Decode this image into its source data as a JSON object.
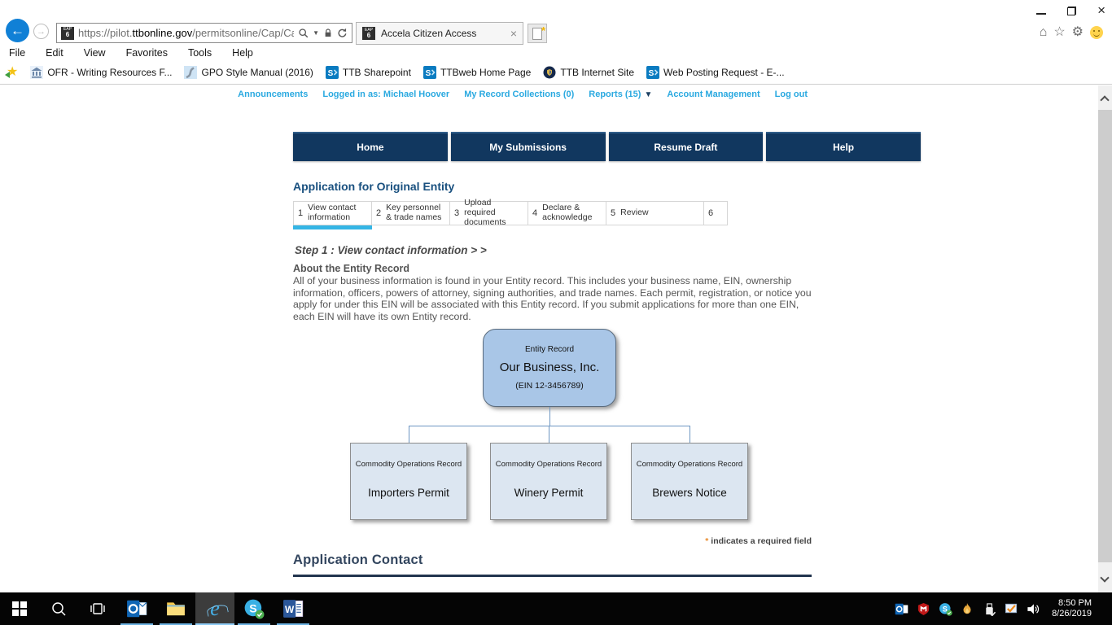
{
  "browser": {
    "favicon": {
      "line1": "EAP",
      "line2": "6"
    },
    "url": {
      "prefix": "https://pilot.",
      "domain": "ttbonline.gov",
      "path": "/permitsonline/Cap/Cap"
    },
    "tab_title": "Accela Citizen Access",
    "menu": [
      "File",
      "Edit",
      "View",
      "Favorites",
      "Tools",
      "Help"
    ],
    "favorites": [
      {
        "label": "OFR - Writing Resources F..."
      },
      {
        "label": "GPO Style Manual (2016)"
      },
      {
        "label": "TTB Sharepoint"
      },
      {
        "label": "TTBweb Home Page"
      },
      {
        "label": "TTB Internet Site"
      },
      {
        "label": "Web Posting Request - E-..."
      }
    ]
  },
  "site": {
    "top_links": [
      "Announcements",
      "Logged in as: Michael Hoover",
      "My Record Collections (0)",
      "Reports (15)",
      "Account Management",
      "Log out"
    ],
    "nav": [
      "Home",
      "My Submissions",
      "Resume Draft",
      "Help"
    ],
    "page_title": "Application for Original Entity",
    "steps": [
      {
        "num": "1",
        "label": "View contact information"
      },
      {
        "num": "2",
        "label": "Key personnel & trade names"
      },
      {
        "num": "3",
        "label": "Upload required documents"
      },
      {
        "num": "4",
        "label": "Declare & acknowledge"
      },
      {
        "num": "5",
        "label": "Review"
      },
      {
        "num": "6",
        "label": ""
      }
    ],
    "step_heading": "Step 1 : View contact information > >",
    "about_heading": "About the Entity Record",
    "about_text": "All of your business information is found in your Entity record. This includes your business name, EIN, ownership information, officers, powers of attorney, signing authorities, and trade names. Each permit, registration, or notice you apply for under this EIN will be associated with this Entity record. If you submit applications for more than one EIN, each EIN will have its own Entity record.",
    "diagram": {
      "root": {
        "type_label": "Entity Record",
        "name": "Our Business, Inc.",
        "ein": "(EIN 12-3456789)"
      },
      "children": [
        {
          "type_label": "Commodity Operations Record",
          "name": "Importers Permit"
        },
        {
          "type_label": "Commodity Operations Record",
          "name": "Winery Permit"
        },
        {
          "type_label": "Commodity Operations Record",
          "name": "Brewers Notice"
        }
      ]
    },
    "required_star": "*",
    "required_text": "indicates a required field",
    "section_heading": "Application Contact"
  },
  "taskbar": {
    "time": "8:50 PM",
    "date": "8/26/2019"
  },
  "colors": {
    "accent_cyan": "#2aa9e0",
    "navy_button": "#11375f",
    "heading_blue": "#19507f",
    "section_navy": "#33465f",
    "entity_fill": "#a9c6e7",
    "child_fill": "#dce6f1",
    "required_star": "#e98b2d"
  }
}
